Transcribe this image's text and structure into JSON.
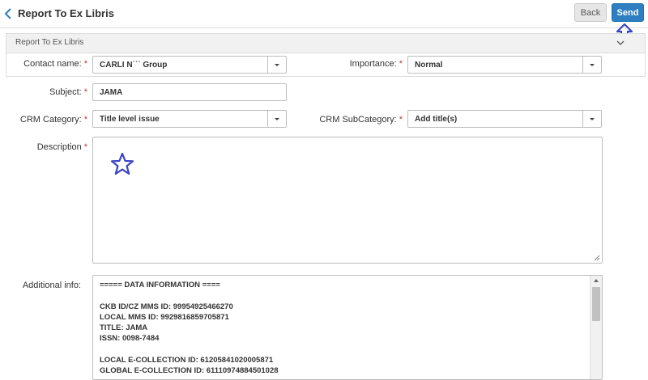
{
  "header": {
    "title": "Report To Ex Libris",
    "back_label": "Back",
    "send_label": "Send"
  },
  "section": {
    "title": "Report To Ex Libris"
  },
  "form": {
    "contact_name": {
      "label": "Contact name:",
      "value": "CARLI N˙˙˙ Group"
    },
    "importance": {
      "label": "Importance:",
      "value": "Normal"
    },
    "subject": {
      "label": "Subject:",
      "value": "JAMA"
    },
    "crm_category": {
      "label": "CRM Category:",
      "value": "Title level issue"
    },
    "crm_subcategory": {
      "label": "CRM SubCategory:",
      "value": "Add title(s)"
    },
    "description": {
      "label": "Description",
      "value": ""
    },
    "additional_info": {
      "label": "Additional info:",
      "lines": [
        "===== DATA INFORMATION ====",
        "",
        "CKB ID/CZ MMS ID: 99954925466270",
        "LOCAL MMS ID: 9929816859705871",
        "TITLE: JAMA",
        "ISSN: 0098-7484",
        "",
        "LOCAL E-COLLECTION ID: 61205841020005871",
        "GLOBAL E-COLLECTION ID: 61110974884501028"
      ]
    },
    "required_mark": "*"
  },
  "colors": {
    "accent": "#2d7fc1",
    "annotation": "#3b44c6",
    "required": "#c0392b"
  },
  "icons": {
    "back": "chevron-left-icon",
    "annotation_arrow": "up-arrow-icon",
    "annotation_star": "star-icon",
    "section_toggle": "chevron-down-icon"
  }
}
